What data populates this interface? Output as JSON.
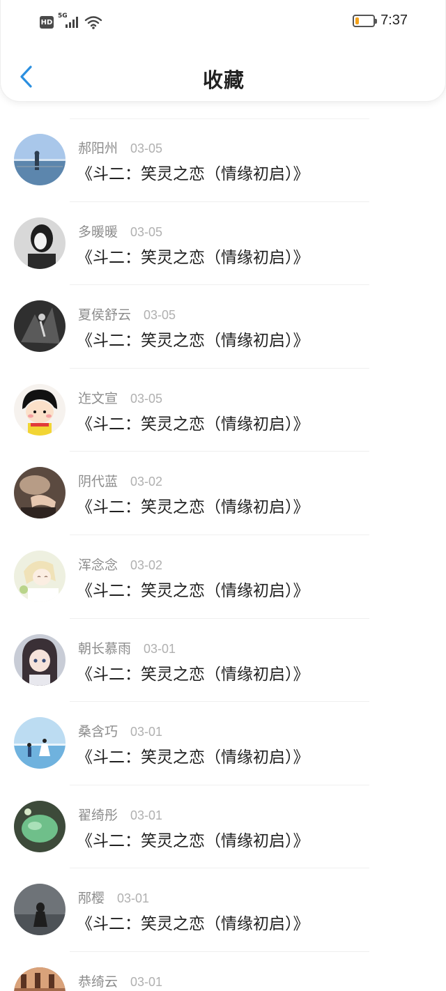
{
  "status_bar": {
    "hd": "HD",
    "network": "5G",
    "time": "7:37",
    "battery_level": 0.2,
    "battery_color": "#f4a21a"
  },
  "nav": {
    "back_icon": "chevron-left-icon",
    "back_color": "#2b8fe0",
    "title": "收藏"
  },
  "favorites": [
    {
      "name": "郝阳州",
      "date": "03-05",
      "title": "《斗二：笑灵之恋（情缘初启）》"
    },
    {
      "name": "多暖暖",
      "date": "03-05",
      "title": "《斗二：笑灵之恋（情缘初启）》"
    },
    {
      "name": "夏侯舒云",
      "date": "03-05",
      "title": "《斗二：笑灵之恋（情缘初启）》"
    },
    {
      "name": "迮文宣",
      "date": "03-05",
      "title": "《斗二：笑灵之恋（情缘初启）》"
    },
    {
      "name": "阴代蓝",
      "date": "03-02",
      "title": "《斗二：笑灵之恋（情缘初启）》"
    },
    {
      "name": "浑念念",
      "date": "03-02",
      "title": "《斗二：笑灵之恋（情缘初启）》"
    },
    {
      "name": "朝长慕雨",
      "date": "03-01",
      "title": "《斗二：笑灵之恋（情缘初启）》"
    },
    {
      "name": "桑含巧",
      "date": "03-01",
      "title": "《斗二：笑灵之恋（情缘初启）》"
    },
    {
      "name": "翟绮彤",
      "date": "03-01",
      "title": "《斗二：笑灵之恋（情缘初启）》"
    },
    {
      "name": "邴樱",
      "date": "03-01",
      "title": "《斗二：笑灵之恋（情缘初启）》"
    },
    {
      "name": "恭绮云",
      "date": "03-01",
      "title": ""
    }
  ]
}
